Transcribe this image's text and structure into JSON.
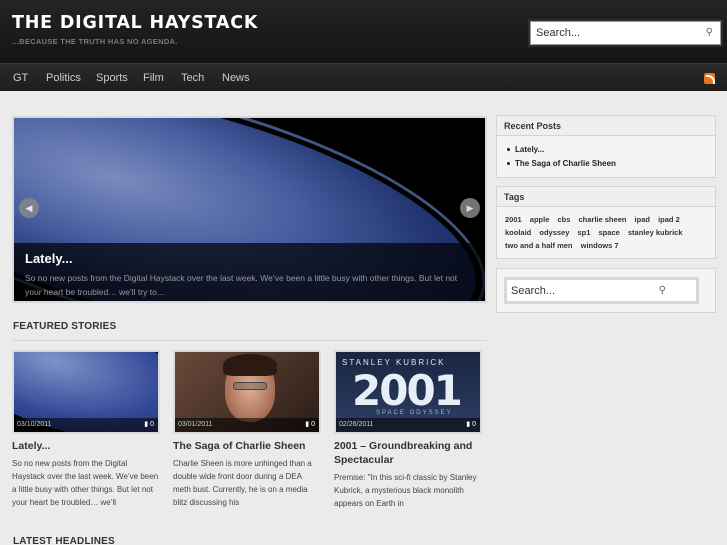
{
  "site": {
    "title": "THE DIGITAL HAYSTACK",
    "tagline": "...BECAUSE THE TRUTH HAS NO AGENDA."
  },
  "search": {
    "placeholder": "Search...",
    "icon": "search-icon"
  },
  "nav": {
    "items": [
      "GT",
      "Politics",
      "Sports",
      "Film",
      "Tech",
      "News"
    ],
    "rss_icon": "rss-icon"
  },
  "slider": {
    "title": "Lately...",
    "excerpt": "So no new posts from the Digital Haystack over the last week. We’ve been a little busy with other things. But let not your heart be troubled… we’ll try to…",
    "prev_icon": "chevron-left-icon",
    "next_icon": "chevron-right-icon"
  },
  "featured": {
    "heading": "FEATURED STORIES",
    "items": [
      {
        "date": "03/10/2011",
        "comments": "0",
        "title": "Lately...",
        "excerpt": "So no new posts from the Digital Haystack over the last week. We’ve been a little busy with other things. But let not your heart be troubled… we’ll"
      },
      {
        "date": "03/01/2011",
        "comments": "0",
        "title": "The Saga of Charlie Sheen",
        "excerpt": "Charlie Sheen is more unhinged than a double wide front door during a DEA meth bust. Currently, he is on a media blitz discussing his"
      },
      {
        "date": "02/26/2011",
        "comments": "0",
        "title": "2001 – Groundbreaking and Spectacular",
        "excerpt": "Premise: \"In this sci-fi classic by Stanley Kubrick, a mysterious black monolith appears on Earth in"
      }
    ]
  },
  "latest": {
    "heading": "LATEST HEADLINES"
  },
  "sidebar": {
    "recent_title": "Recent Posts",
    "recent": [
      "Lately...",
      "The Saga of Charlie Sheen"
    ],
    "tags_title": "Tags",
    "tags": [
      "2001",
      "apple",
      "cbs",
      "charlie sheen",
      "ipad",
      "ipad 2",
      "koolaid",
      "odyssey",
      "sp1",
      "space",
      "stanley kubrick",
      "two and a half men",
      "windows 7"
    ]
  },
  "poster": {
    "line1": "STANLEY KUBRICK",
    "line2": "2001",
    "line3": "SPACE ODYSSEY"
  }
}
